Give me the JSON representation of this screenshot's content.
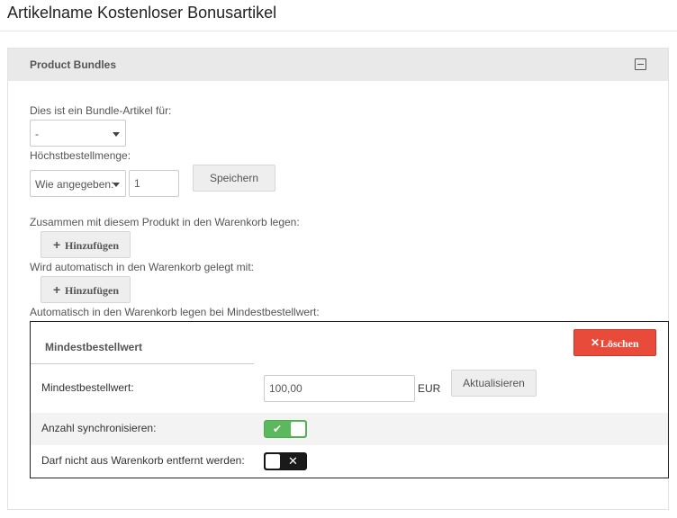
{
  "page": {
    "title": "Artikelname Kostenloser Bonusartikel"
  },
  "panel": {
    "title": "Product Bundles",
    "bundle_label": "Dies ist ein Bundle-Artikel für:",
    "bundle_select_value": "-",
    "max_qty_label": "Höchstbestellmenge:",
    "max_qty_select_value": "Wie angegeben:",
    "max_qty_input_value": "1",
    "save_button": "Speichern",
    "add_together_label": "Zusammen mit diesem Produkt in den Warenkorb legen:",
    "add_button_1": "Hinzufügen",
    "auto_add_label": "Wird automatisch in den Warenkorb gelegt mit:",
    "add_button_2": "Hinzufügen",
    "min_order_auto_label": "Automatisch in den Warenkorb legen bei Mindestbestellwert:"
  },
  "min_order_box": {
    "title": "Mindestbestellwert",
    "delete_button": "Löschen",
    "rows": [
      {
        "label": "Mindestbestellwert:",
        "value": "100,00",
        "unit": "EUR",
        "update_button": "Aktualisieren"
      },
      {
        "label": "Anzahl synchronisieren:",
        "state": "on"
      },
      {
        "label": "Darf nicht aus Warenkorb entfernt werden:",
        "state": "off"
      }
    ]
  },
  "icons": {
    "collapse": "minus-square-icon",
    "add": "plus-icon",
    "delete": "times-icon",
    "toggle_on": "check-icon",
    "toggle_off": "times-icon"
  },
  "colors": {
    "delete_red": "#e84b3a",
    "toggle_green": "#5cb85c",
    "toggle_dark": "#1a1a1a",
    "panel_header": "#e9e9e9"
  }
}
